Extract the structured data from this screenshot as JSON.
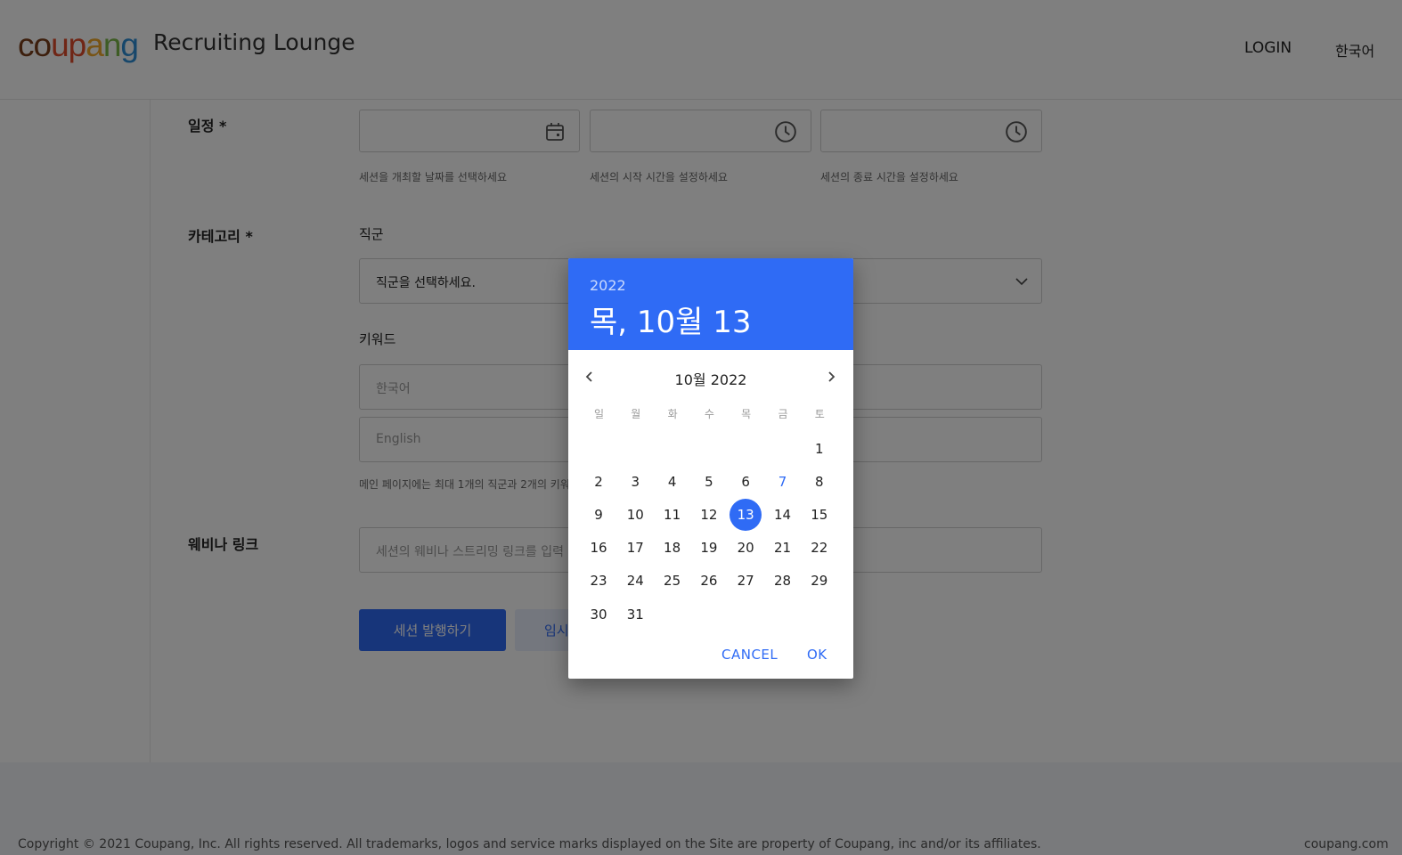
{
  "header": {
    "logo_text": "coupang",
    "title": "Recruiting Lounge",
    "login": "LOGIN",
    "language": "한국어"
  },
  "form": {
    "schedule_label": "일정 *",
    "date_help": "세션을 개최할 날짜를 선택하세요",
    "start_help": "세션의 시작 시간을 설정하세요",
    "end_help": "세션의 종료 시간을 설정하세요",
    "category_label": "카테고리 *",
    "job_label": "직군",
    "job_select_value": "직군을 선택하세요.",
    "keyword_label": "키워드",
    "keyword_ko_placeholder": "한국어",
    "keyword_en_placeholder": "English",
    "keyword_help": "메인 페이지에는 최대 1개의 직군과 2개의 키워",
    "webinar_label": "웨비나 링크",
    "webinar_placeholder": "세션의 웨비나 스트리밍 링크를 입력",
    "publish_button": "세션 발행하기",
    "temp_button": "임시"
  },
  "footer": {
    "copyright": "Copyright © 2021 Coupang, Inc. All rights reserved. All trademarks, logos and service marks displayed on the Site are property of Coupang, inc and/or its affiliates.",
    "domain": "coupang.com"
  },
  "picker": {
    "year": "2022",
    "selected_date": "목, 10월 13",
    "month_title": "10월 2022",
    "weekdays": [
      "일",
      "월",
      "화",
      "수",
      "목",
      "금",
      "토"
    ],
    "first_weekday": 6,
    "days_in_month": 31,
    "selected_day": 13,
    "highlight_day": 7,
    "cancel": "CANCEL",
    "ok": "OK"
  },
  "colors": {
    "accent": "#2f6bf5",
    "overlay": "rgba(0,0,0,0.5)"
  }
}
